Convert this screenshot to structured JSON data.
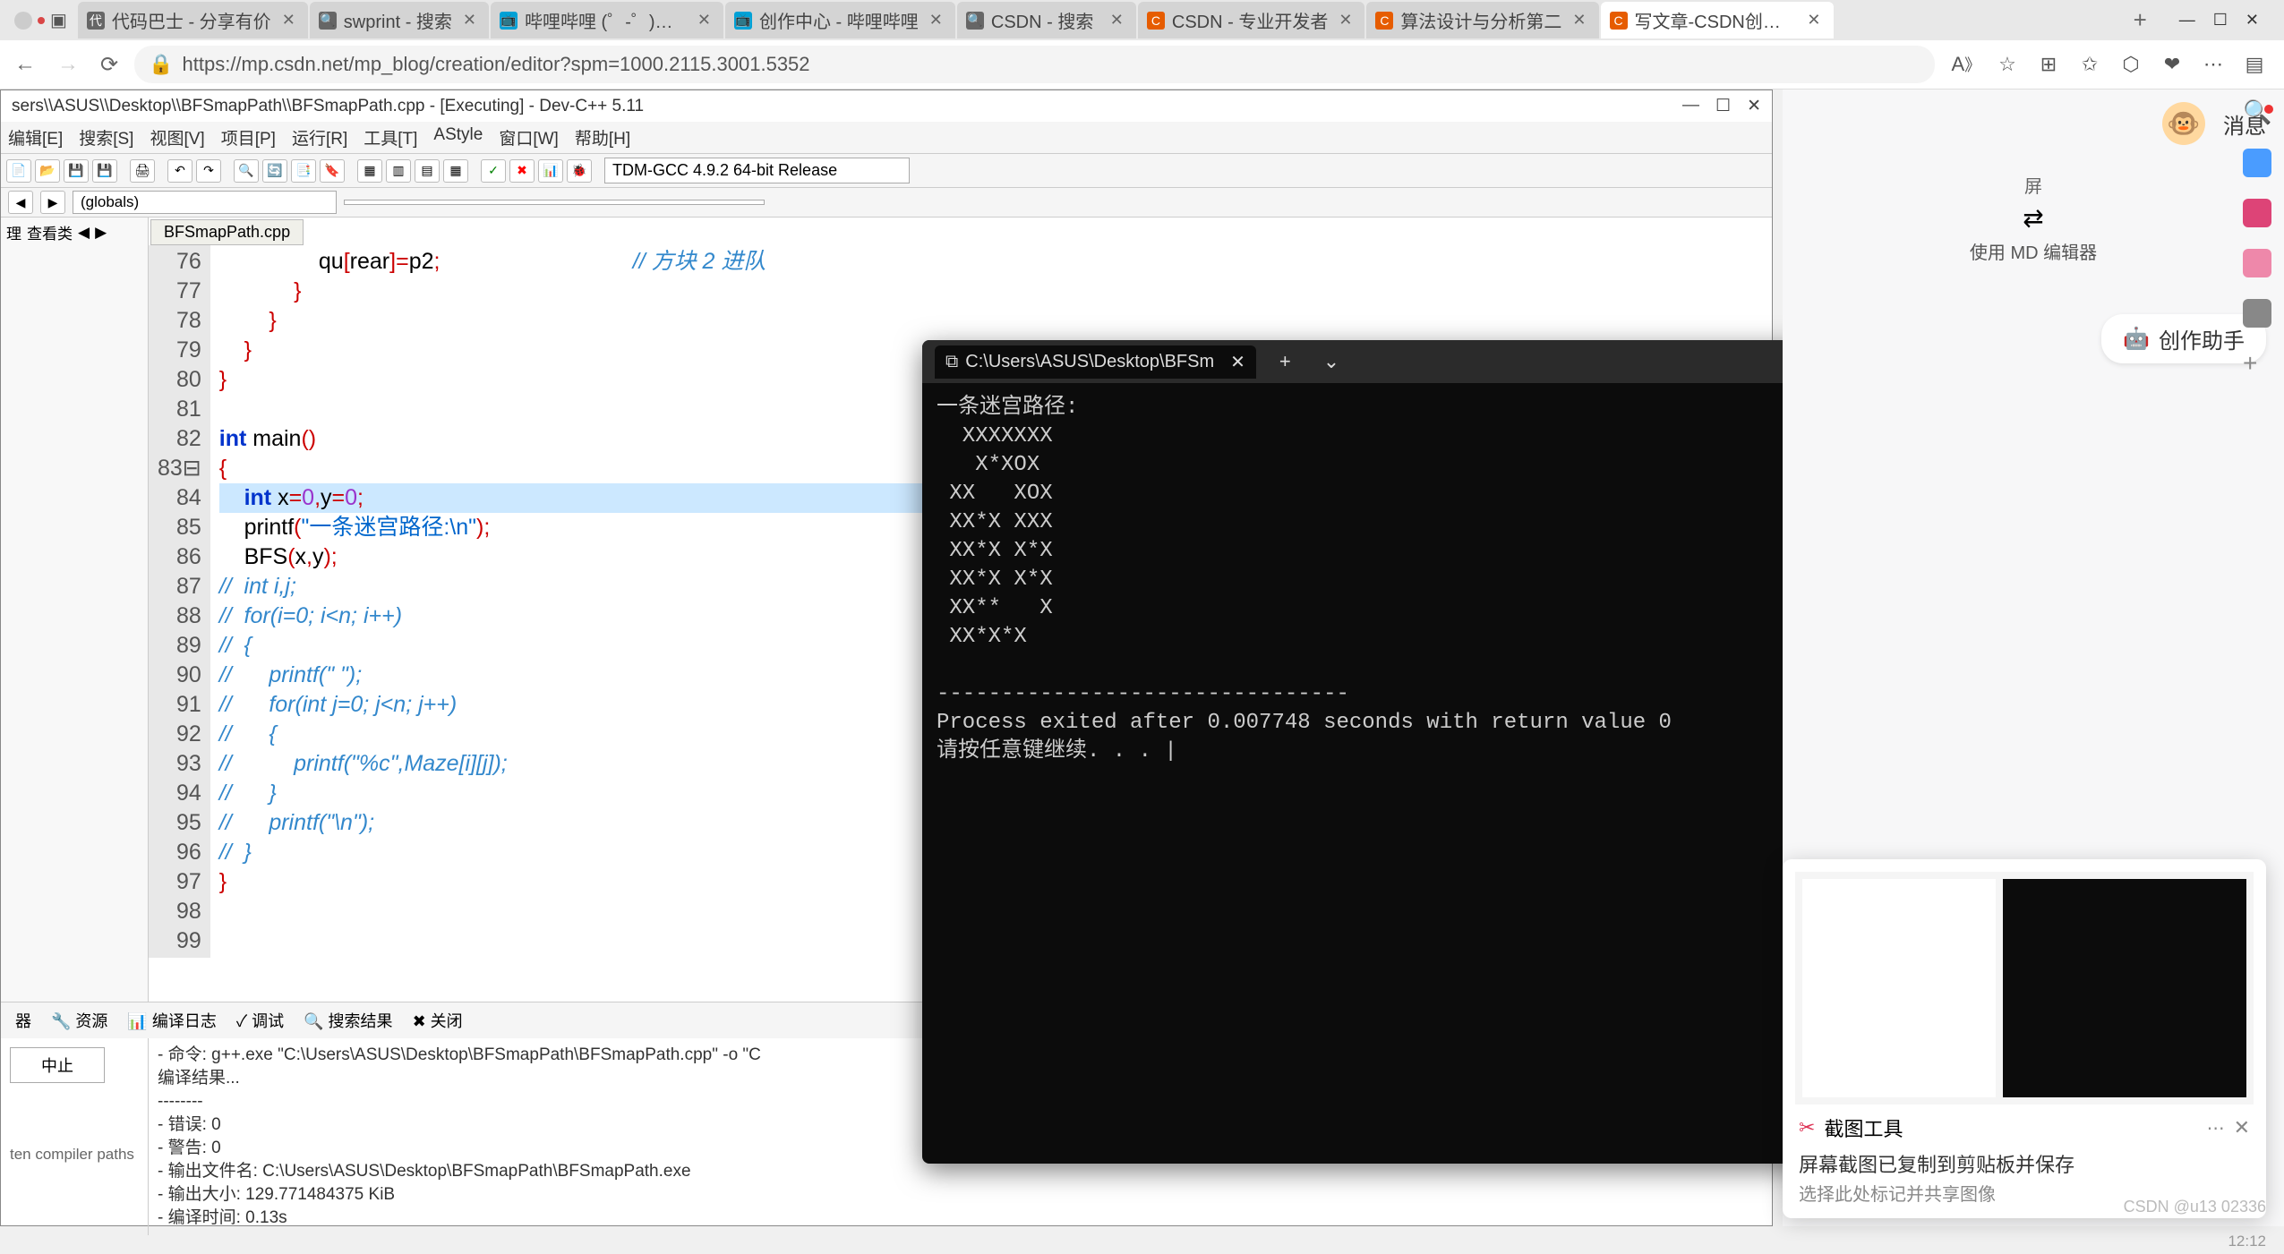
{
  "browser": {
    "tabs": [
      {
        "icon": "代",
        "title": "代码巴士 - 分享有价"
      },
      {
        "icon": "🔍",
        "title": "swprint - 搜索"
      },
      {
        "icon": "📺",
        "title": "哔哩哔哩 (゜-゜)つロ"
      },
      {
        "icon": "📺",
        "title": "创作中心 - 哔哩哔哩"
      },
      {
        "icon": "🔍",
        "title": "CSDN - 搜索"
      },
      {
        "icon": "C",
        "title": "CSDN - 专业开发者"
      },
      {
        "icon": "C",
        "title": "算法设计与分析第二"
      },
      {
        "icon": "C",
        "title": "写文章-CSDN创作中",
        "active": true
      }
    ],
    "url": "https://mp.csdn.net/mp_blog/creation/editor?spm=1000.2115.3001.5352"
  },
  "devcpp": {
    "title": "sers\\\\ASUS\\\\Desktop\\\\BFSmapPath\\\\BFSmapPath.cpp - [Executing] - Dev-C++ 5.11",
    "menus": [
      "编辑[E]",
      "搜索[S]",
      "视图[V]",
      "项目[P]",
      "运行[R]",
      "工具[T]",
      "AStyle",
      "窗口[W]",
      "帮助[H]"
    ],
    "compiler": "TDM-GCC 4.9.2 64-bit Release",
    "globals": "(globals)",
    "side_tabs": [
      "理",
      "查看类"
    ],
    "file_tab": "BFSmapPath.cpp",
    "lines": [
      {
        "n": "76",
        "frag": [
          {
            "t": "                ",
            "c": ""
          },
          {
            "t": "qu",
            "c": ""
          },
          {
            "t": "[",
            "c": "sym"
          },
          {
            "t": "rear",
            "c": ""
          },
          {
            "t": "]=",
            "c": "sym"
          },
          {
            "t": "p2",
            "c": ""
          },
          {
            "t": ";",
            "c": "sym"
          },
          {
            "t": "                               // 方块 2 进队",
            "c": "cm"
          }
        ]
      },
      {
        "n": "77",
        "frag": [
          {
            "t": "            ",
            "c": ""
          },
          {
            "t": "}",
            "c": "sym"
          }
        ]
      },
      {
        "n": "78",
        "frag": [
          {
            "t": "        ",
            "c": ""
          },
          {
            "t": "}",
            "c": "sym"
          }
        ]
      },
      {
        "n": "79",
        "frag": [
          {
            "t": "    ",
            "c": ""
          },
          {
            "t": "}",
            "c": "sym"
          }
        ]
      },
      {
        "n": "80",
        "frag": [
          {
            "t": "",
            "c": ""
          },
          {
            "t": "}",
            "c": "sym"
          }
        ]
      },
      {
        "n": "81",
        "frag": [
          {
            "t": "",
            "c": ""
          }
        ]
      },
      {
        "n": "82",
        "frag": [
          {
            "t": "int ",
            "c": "kw"
          },
          {
            "t": "main",
            "c": ""
          },
          {
            "t": "()",
            "c": "sym"
          }
        ]
      },
      {
        "n": "83⊟",
        "frag": [
          {
            "t": "{",
            "c": "sym"
          }
        ]
      },
      {
        "n": "84",
        "hl": true,
        "frag": [
          {
            "t": "    ",
            "c": ""
          },
          {
            "t": "int ",
            "c": "kw"
          },
          {
            "t": "x",
            "c": ""
          },
          {
            "t": "=",
            "c": "sym"
          },
          {
            "t": "0",
            "c": "num"
          },
          {
            "t": ",",
            "c": "sym"
          },
          {
            "t": "y",
            "c": ""
          },
          {
            "t": "=",
            "c": "sym"
          },
          {
            "t": "0",
            "c": "num"
          },
          {
            "t": ";",
            "c": "sym"
          }
        ]
      },
      {
        "n": "85",
        "frag": [
          {
            "t": "    ",
            "c": ""
          },
          {
            "t": "printf",
            "c": ""
          },
          {
            "t": "(",
            "c": "sym"
          },
          {
            "t": "\"一条迷宫路径:\\n\"",
            "c": "str"
          },
          {
            "t": ");",
            "c": "sym"
          }
        ]
      },
      {
        "n": "86",
        "frag": [
          {
            "t": "    ",
            "c": ""
          },
          {
            "t": "BFS",
            "c": ""
          },
          {
            "t": "(",
            "c": "sym"
          },
          {
            "t": "x",
            "c": ""
          },
          {
            "t": ",",
            "c": "sym"
          },
          {
            "t": "y",
            "c": ""
          },
          {
            "t": ");",
            "c": "sym"
          }
        ]
      },
      {
        "n": "87",
        "frag": [
          {
            "t": "//  int i,j;",
            "c": "cm"
          }
        ]
      },
      {
        "n": "88",
        "frag": [
          {
            "t": "//  for(i=0; i<n; i++)",
            "c": "cm"
          }
        ]
      },
      {
        "n": "89",
        "frag": [
          {
            "t": "//  {",
            "c": "cm"
          }
        ]
      },
      {
        "n": "90",
        "frag": [
          {
            "t": "//      printf(\" \");",
            "c": "cm"
          }
        ]
      },
      {
        "n": "91",
        "frag": [
          {
            "t": "//      for(int j=0; j<n; j++)",
            "c": "cm"
          }
        ]
      },
      {
        "n": "92",
        "frag": [
          {
            "t": "//      {",
            "c": "cm"
          }
        ]
      },
      {
        "n": "93",
        "frag": [
          {
            "t": "//          printf(\"%c\",Maze[i][j]);",
            "c": "cm"
          }
        ]
      },
      {
        "n": "94",
        "frag": [
          {
            "t": "//      }",
            "c": "cm"
          }
        ]
      },
      {
        "n": "95",
        "frag": [
          {
            "t": "//      printf(\"\\n\");",
            "c": "cm"
          }
        ]
      },
      {
        "n": "96",
        "frag": [
          {
            "t": "//  }",
            "c": "cm"
          }
        ]
      },
      {
        "n": "97",
        "frag": [
          {
            "t": "}",
            "c": "sym"
          }
        ]
      },
      {
        "n": "98",
        "frag": [
          {
            "t": "",
            "c": ""
          }
        ]
      },
      {
        "n": "99",
        "frag": [
          {
            "t": "",
            "c": ""
          }
        ]
      }
    ],
    "bottom_tabs": [
      "器",
      "🔧 资源",
      "📊 编译日志",
      "✓ 调试",
      "🔍 搜索结果",
      "✖ 关闭"
    ],
    "stop_label": "中止",
    "compile_log": [
      "- 命令: g++.exe \"C:\\Users\\ASUS\\Desktop\\BFSmapPath\\BFSmapPath.cpp\" -o \"C",
      "",
      "编译结果...",
      "--------",
      "- 错误: 0",
      "- 警告: 0",
      "- 输出文件名: C:\\Users\\ASUS\\Desktop\\BFSmapPath\\BFSmapPath.exe",
      "- 输出大小: 129.771484375 KiB",
      "- 编译时间: 0.13s"
    ],
    "note_left": "ten compiler paths"
  },
  "terminal": {
    "title": "C:\\Users\\ASUS\\Desktop\\BFSm",
    "output": "一条迷宫路径:\n  XXXXXXX\n   X*XOX\n XX   XOX\n XX*X XXX\n XX*X X*X\n XX*X X*X\n XX**   X\n XX*X*X\n\n--------------------------------\nProcess exited after 0.007748 seconds with return value 0\n请按任意键继续. . . |"
  },
  "csdn": {
    "msg_label": "消息",
    "md_label": "使用 MD 编辑器",
    "md_sub": "屏",
    "assist_label": "创作助手"
  },
  "snip": {
    "title": "截图工具",
    "desc": "屏幕截图已复制到剪贴板并保存",
    "sub": "选择此处标记并共享图像"
  },
  "watermark": "CSDN @u13   02336",
  "time": "12:12"
}
